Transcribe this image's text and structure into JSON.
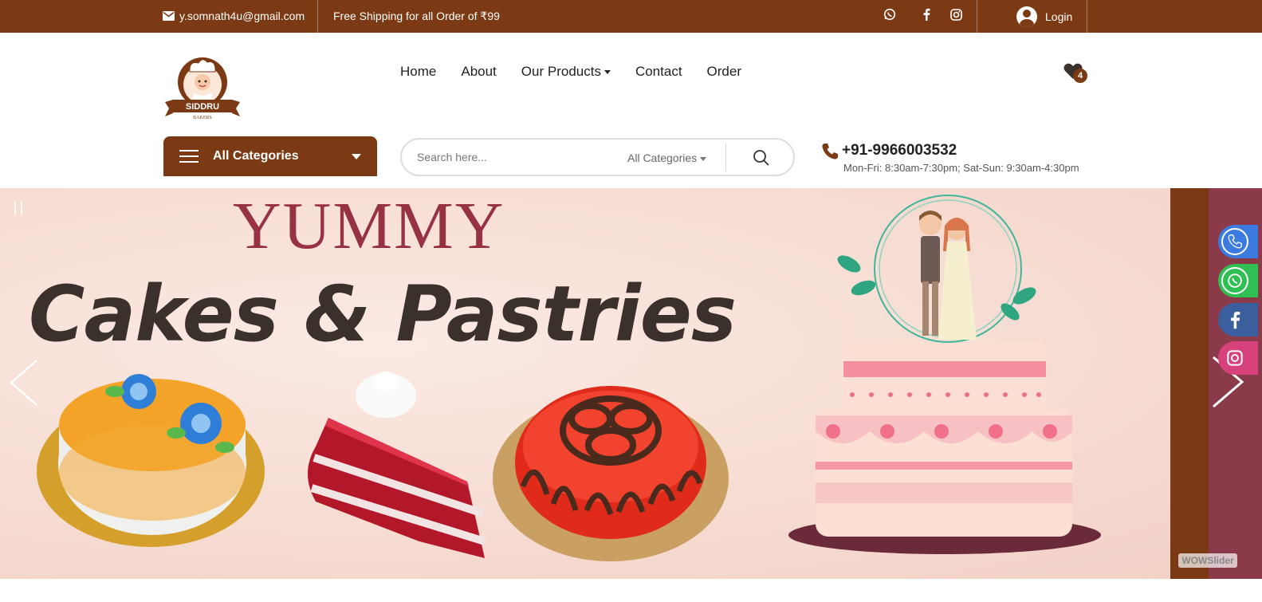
{
  "topbar": {
    "email": "y.somnath4u@gmail.com",
    "shipping": "Free Shipping for all Order of ₹99",
    "social_icons": [
      "whatsapp-icon",
      "facebook-icon",
      "instagram-icon"
    ],
    "login": "Login"
  },
  "header": {
    "logo_text": "SIDDRU",
    "logo_subtext": "BAKERS",
    "nav": [
      "Home",
      "About",
      "Our Products",
      "Contact",
      "Order"
    ],
    "wishlist_count": "4"
  },
  "categories": {
    "label": "All Categories"
  },
  "search": {
    "placeholder": "Search here...",
    "category": "All Categories"
  },
  "contact": {
    "phone": "+91-9966003532",
    "hours": "Mon-Fri: 8:30am-7:30pm; Sat-Sun: 9:30am-4:30pm"
  },
  "banner": {
    "title_small": "YUMMY",
    "title_large": "Cakes & Pastries",
    "watermark": "WOWSlider"
  },
  "colors": {
    "brand": "#7b3a13",
    "accent": "#963244"
  }
}
